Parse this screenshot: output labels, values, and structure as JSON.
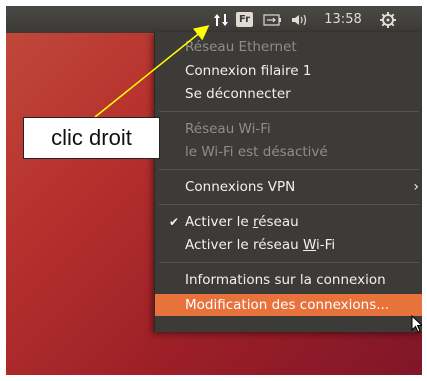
{
  "topbar": {
    "network_icon": "network-transfer-icon",
    "keyboard_layout": "Fr",
    "battery_icon": "battery-icon",
    "volume_icon": "volume-icon",
    "clock": "13:58",
    "system_icon": "gear-icon"
  },
  "menu": {
    "ethernet_header": "Réseau Ethernet",
    "wired_connection": "Connexion filaire 1",
    "disconnect": "Se déconnecter",
    "wifi_header": "Réseau Wi-Fi",
    "wifi_disabled": "le Wi-Fi est désactivé",
    "vpn": "Connexions VPN",
    "enable_network_prefix": "Activer le ",
    "enable_network_accel": "r",
    "enable_network_suffix": "éseau",
    "enable_wifi_prefix": "Activer le réseau ",
    "enable_wifi_accel": "W",
    "enable_wifi_suffix": "i-Fi",
    "connection_info": "Informations sur la connexion",
    "edit_connections": "Modification des connexions..."
  },
  "annotation": {
    "callout_text": "clic droit"
  },
  "colors": {
    "highlight": "#e8723c",
    "panel": "#3c3b37",
    "wallpaper": "#b7322e",
    "arrow": "#ffff00"
  }
}
